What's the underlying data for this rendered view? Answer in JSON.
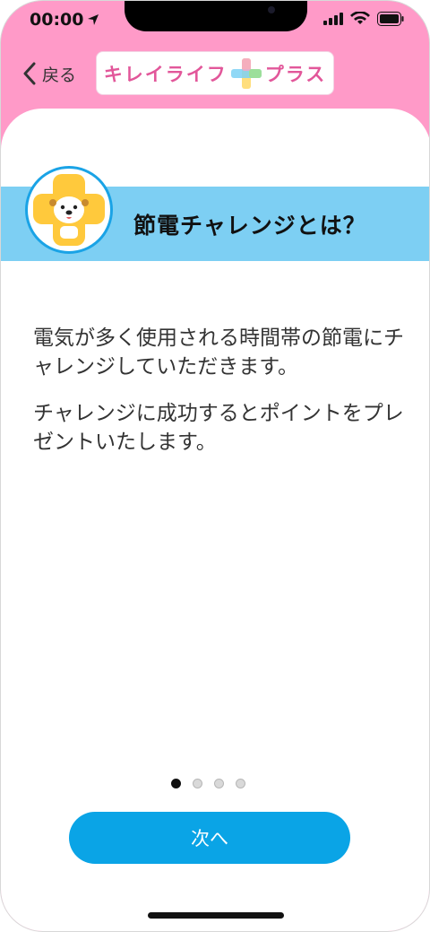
{
  "status_bar": {
    "time": "00:00"
  },
  "header": {
    "back_label": "戻る",
    "logo": {
      "left_text": "キレイライフ",
      "right_text": "プラス"
    }
  },
  "section": {
    "title": "節電チャレンジとは？"
  },
  "content": {
    "paragraphs": [
      "電気が多く使用される時間帯の節電にチャレンジしていただきます。",
      "チャレンジに成功するとポイントをプレゼントいたします。"
    ]
  },
  "pagination": {
    "total": 4,
    "current": 1
  },
  "footer": {
    "next_label": "次へ"
  },
  "colors": {
    "header_bg": "#ff9ac8",
    "title_band": "#7dcff3",
    "primary_button": "#0aa4e6",
    "logo_text": "#e2579a"
  }
}
